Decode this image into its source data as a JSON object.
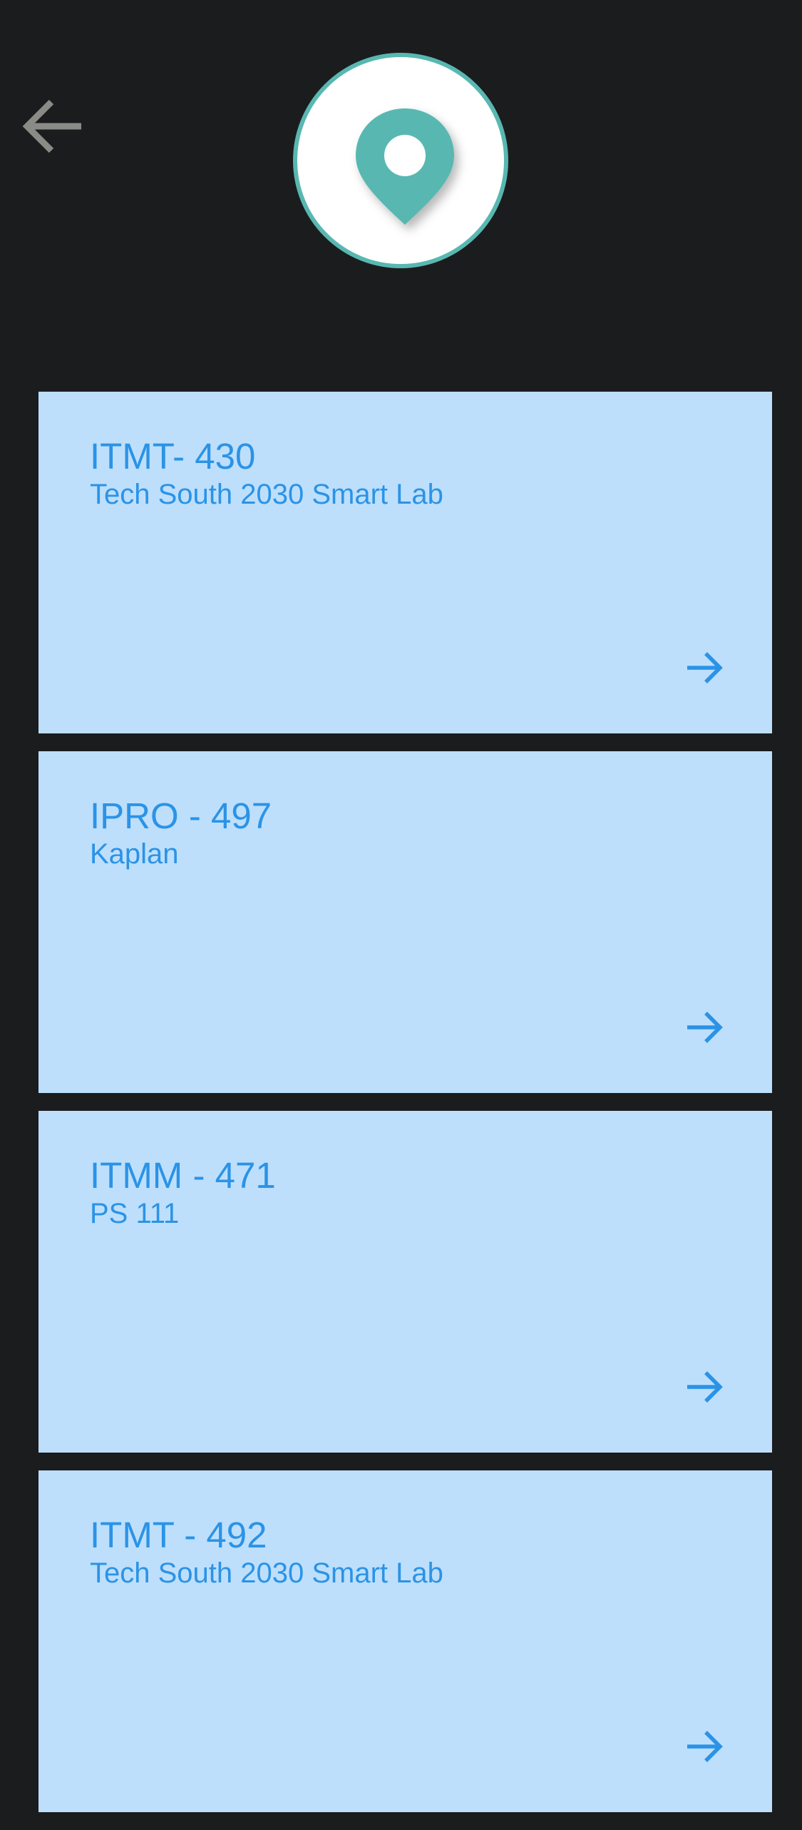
{
  "header": {
    "back_icon": "arrow-left-icon",
    "location_icon": "map-pin-icon"
  },
  "colors": {
    "background": "#1b1c1e",
    "card_background": "#bddffc",
    "card_text": "#2b93e6",
    "accent_teal": "#58b8b1",
    "back_icon": "#8a8a86"
  },
  "courses": [
    {
      "code": "ITMT- 430",
      "location": "Tech South 2030 Smart Lab",
      "icon": "arrow-right-icon"
    },
    {
      "code": "IPRO - 497",
      "location": "Kaplan",
      "icon": "arrow-right-icon"
    },
    {
      "code": "ITMM - 471",
      "location": "PS 111",
      "icon": "arrow-right-icon"
    },
    {
      "code": "ITMT - 492",
      "location": "Tech South 2030 Smart Lab",
      "icon": "arrow-right-icon"
    }
  ]
}
